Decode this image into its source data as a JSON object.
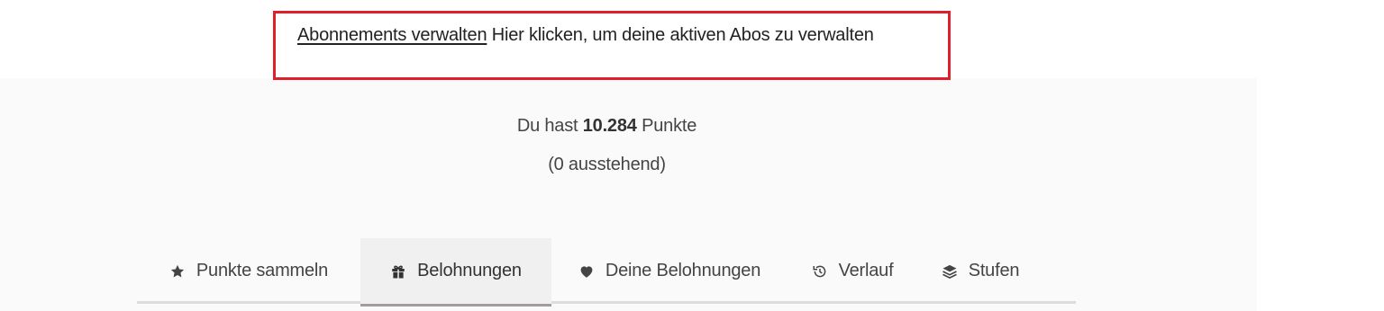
{
  "notice": {
    "link_label": "Abonnements verwalten",
    "text": "Hier klicken, um deine aktiven Abos zu verwalten"
  },
  "points": {
    "prefix": "Du hast",
    "value": "10.284",
    "suffix": "Punkte",
    "pending": "(0 ausstehend)"
  },
  "tabs": [
    {
      "label": "Punkte sammeln",
      "icon": "star-icon"
    },
    {
      "label": "Belohnungen",
      "icon": "gift-icon",
      "active": true
    },
    {
      "label": "Deine Belohnungen",
      "icon": "heart-icon"
    },
    {
      "label": "Verlauf",
      "icon": "history-icon"
    },
    {
      "label": "Stufen",
      "icon": "layers-icon"
    }
  ],
  "colors": {
    "notice_border": "#e31e2b",
    "panel_bg": "#fafafa",
    "active_tab_bg": "#f0f0f0",
    "active_tab_underline": "#a59a9d"
  }
}
